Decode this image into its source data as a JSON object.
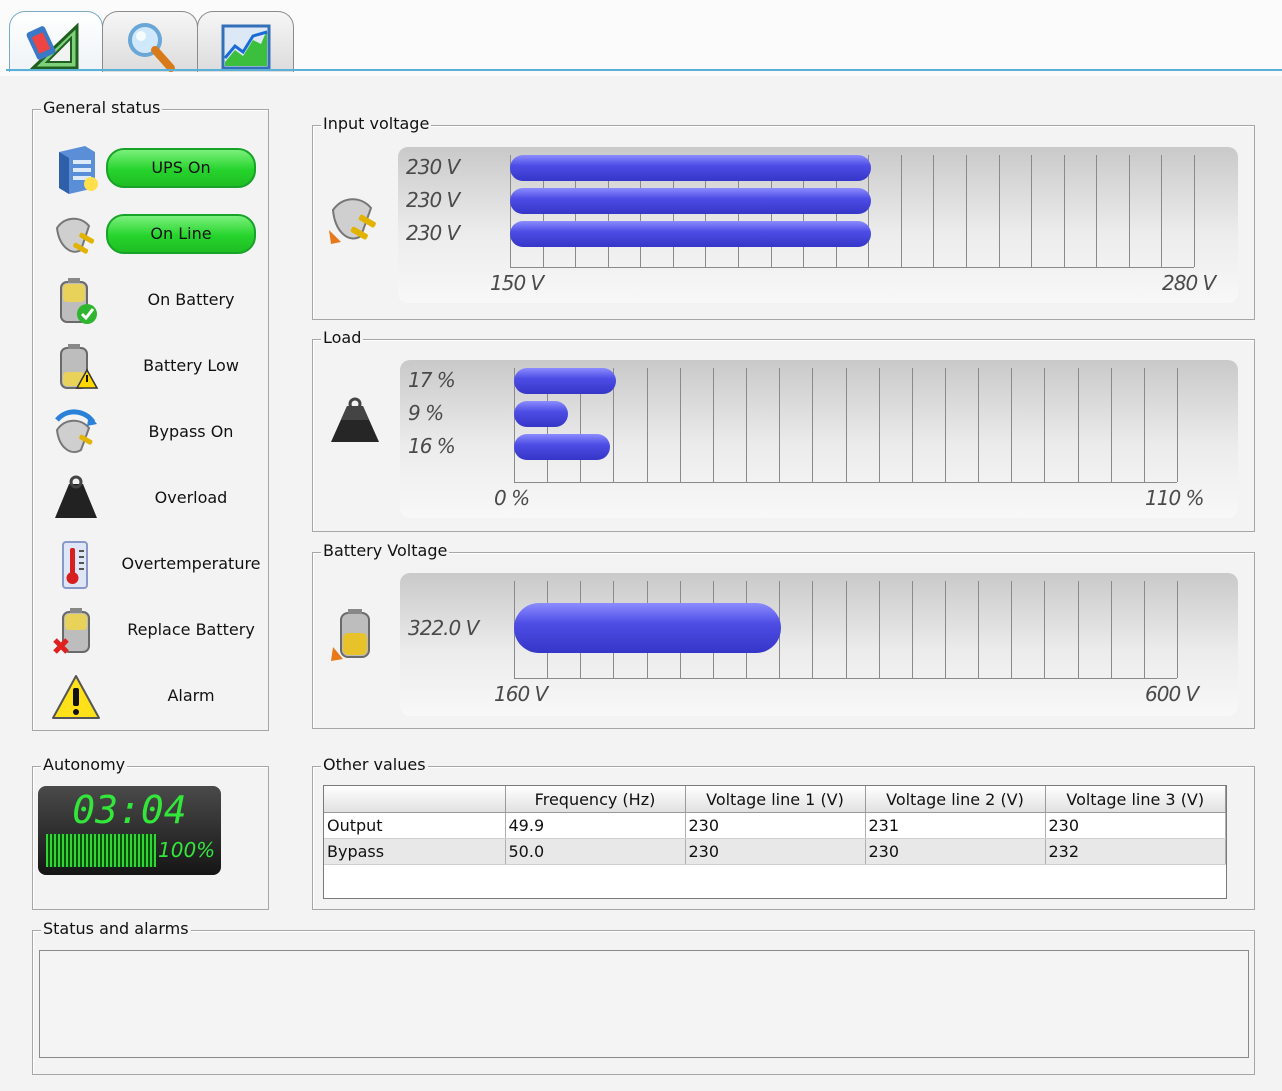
{
  "tabs": [
    {
      "name": "status-tab",
      "icon": "ruler-triangle-icon",
      "active": true
    },
    {
      "name": "search-tab",
      "icon": "magnifier-icon",
      "active": false
    },
    {
      "name": "chart-tab",
      "icon": "chart-icon",
      "active": false
    }
  ],
  "general_status": {
    "title": "General status",
    "items": [
      {
        "label": "UPS On",
        "icon": "ups-server-icon",
        "active": true
      },
      {
        "label": "On Line",
        "icon": "power-plug-icon",
        "active": true
      },
      {
        "label": "On Battery",
        "icon": "battery-check-icon",
        "active": false
      },
      {
        "label": "Battery Low",
        "icon": "battery-warning-icon",
        "active": false
      },
      {
        "label": "Bypass On",
        "icon": "bypass-plug-icon",
        "active": false
      },
      {
        "label": "Overload",
        "icon": "weight-icon",
        "active": false
      },
      {
        "label": "Overtemperature",
        "icon": "thermometer-icon",
        "active": false
      },
      {
        "label": "Replace Battery",
        "icon": "battery-replace-icon",
        "active": false
      },
      {
        "label": "Alarm",
        "icon": "alarm-warning-icon",
        "active": false
      }
    ]
  },
  "input_voltage": {
    "title": "Input voltage",
    "min_label": "150 V",
    "max_label": "280 V",
    "min": 150,
    "max": 280,
    "rows": [
      {
        "label": "230 V",
        "value": 230
      },
      {
        "label": "230 V",
        "value": 230
      },
      {
        "label": "230 V",
        "value": 230
      }
    ]
  },
  "load": {
    "title": "Load",
    "min_label": "0 %",
    "max_label": "110 %",
    "min": 0,
    "max": 110,
    "rows": [
      {
        "label": "17 %",
        "value": 17
      },
      {
        "label": "9 %",
        "value": 9
      },
      {
        "label": "16 %",
        "value": 16
      }
    ]
  },
  "battery_voltage": {
    "title": "Battery Voltage",
    "min_label": "160 V",
    "max_label": "600 V",
    "min": 160,
    "max": 600,
    "rows": [
      {
        "label": "322.0 V",
        "value": 322.0
      }
    ]
  },
  "autonomy": {
    "title": "Autonomy",
    "time": "03:04",
    "percent": "100%"
  },
  "other_values": {
    "title": "Other values",
    "columns": [
      "",
      "Frequency (Hz)",
      "Voltage line 1 (V)",
      "Voltage line 2 (V)",
      "Voltage line 3 (V)"
    ],
    "rows": [
      [
        "Output",
        "49.9",
        "230",
        "231",
        "230"
      ],
      [
        "Bypass",
        "50.0",
        "230",
        "230",
        "232"
      ]
    ]
  },
  "status_alarms": {
    "title": "Status and alarms",
    "text": ""
  },
  "colors": {
    "bar": "#4444dd",
    "active_pill": "#26d42d",
    "lcd_green": "#33e63a"
  }
}
